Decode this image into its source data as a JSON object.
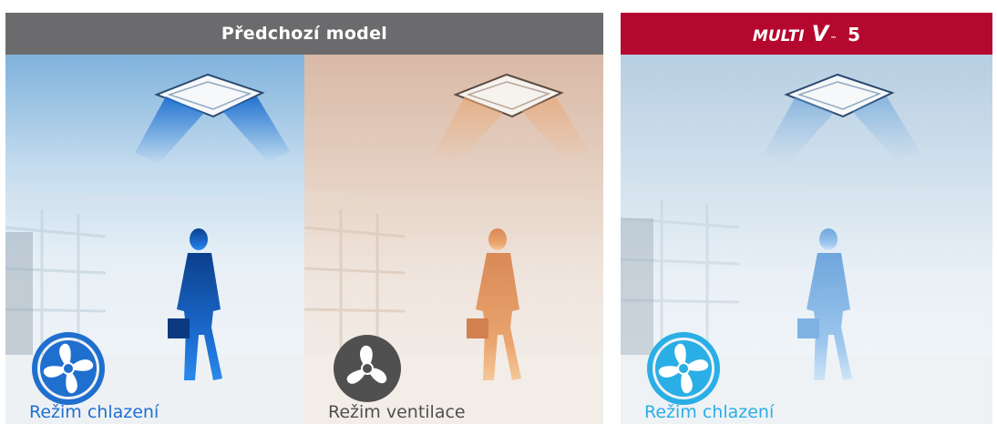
{
  "headers": {
    "previous_model": "Předchozí model",
    "brand": {
      "word": "MULTI",
      "letter": "V",
      "tm": "™",
      "number": "5"
    }
  },
  "panels": [
    {
      "mode_label": "Režim chlazení",
      "icon": "cooling-fan-icon",
      "accent": "#1f6fcf"
    },
    {
      "mode_label": "Režim ventilace",
      "icon": "ventilation-fan-icon",
      "accent": "#505050"
    },
    {
      "mode_label": "Režim chlazení",
      "icon": "cooling-fan-icon",
      "accent": "#2aaee6"
    }
  ],
  "colors": {
    "header_gray": "#6b6b6e",
    "header_red": "#b5082f"
  }
}
